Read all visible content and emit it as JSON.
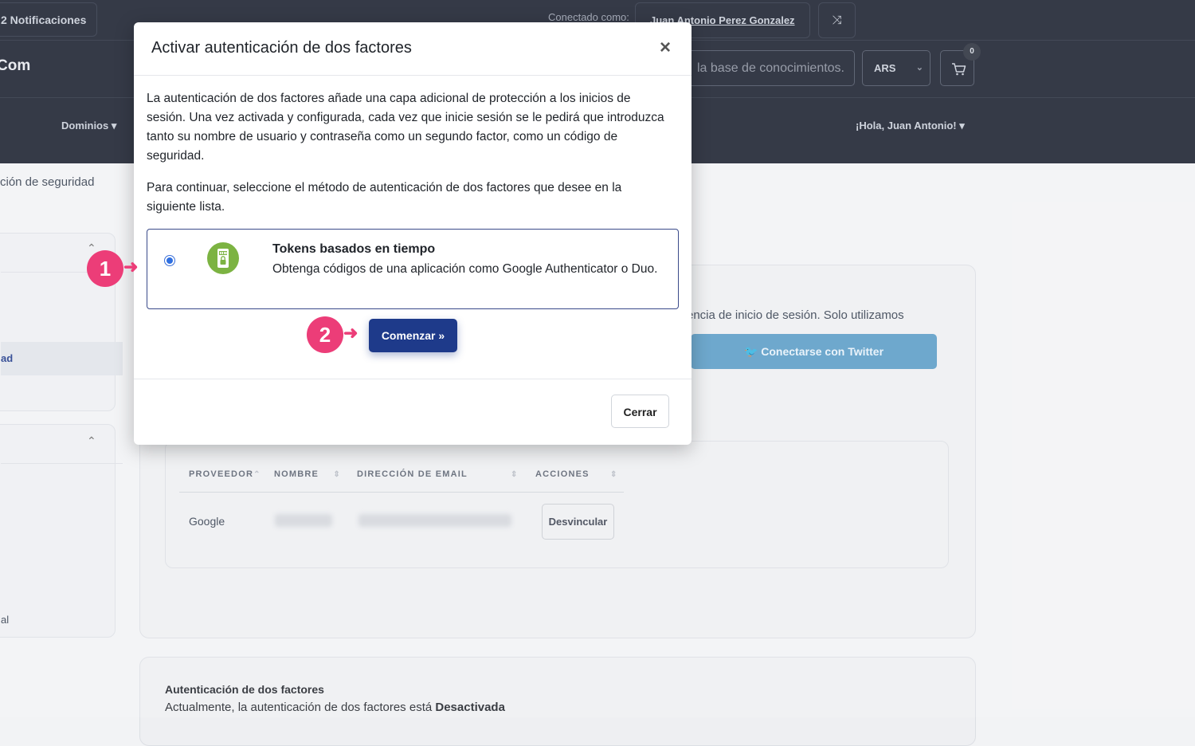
{
  "topbar": {
    "notifications": "2  Notificaciones",
    "connected_label": "Conectado como:",
    "user_name": "Juan Antonio Perez Gonzalez"
  },
  "header": {
    "logo": "Com",
    "kb_search_placeholder": "la base de conocimientos.",
    "currency": "ARS",
    "cart_count": "0"
  },
  "nav": {
    "domains": "Dominios ▾",
    "greeting": "¡Hola, Juan Antonio! ▾"
  },
  "page": {
    "title_fragment": "ción de seguridad",
    "sidebar_active_fragment": "ad",
    "sidebar_bottom_fragment": "al",
    "login_text_fragment": "encia de inicio de sesión. Solo utilizamos",
    "twitter_button": "Conectarse con Twitter",
    "table": {
      "headers": [
        "PROVEEDOR",
        "NOMBRE",
        "DIRECCIÓN DE EMAIL",
        "ACCIONES"
      ],
      "row_provider": "Google",
      "unlink_button": "Desvincular"
    },
    "twofa_heading": "Autenticación de dos factores",
    "twofa_status_prefix": "Actualmente, la autenticación de dos factores está ",
    "twofa_status_value": "Desactivada"
  },
  "modal": {
    "title": "Activar autenticación de dos factores",
    "close_icon": "×",
    "paragraph1": "La autenticación de dos factores añade una capa adicional de protección a los inicios de sesión. Una vez activada y configurada, cada vez que inicie sesión se le pedirá que introduzca tanto su nombre de usuario y contraseña como un segundo factor, como un código de seguridad.",
    "paragraph2": "Para continuar, seleccione el método de autenticación de dos factores que desee en la siguiente lista.",
    "option": {
      "title": "Tokens basados en tiempo",
      "description": "Obtenga códigos de una aplicación como Google Authenticator o Duo.",
      "icon": "authenticator-icon"
    },
    "start_button": "Comenzar »",
    "close_button": "Cerrar"
  },
  "steps": {
    "step1": "1",
    "step2": "2"
  },
  "colors": {
    "accent": "#1e3a8a",
    "step_marker": "#ec3d78",
    "twitter": "#5a9cc7",
    "totp_icon": "#7cb342"
  }
}
